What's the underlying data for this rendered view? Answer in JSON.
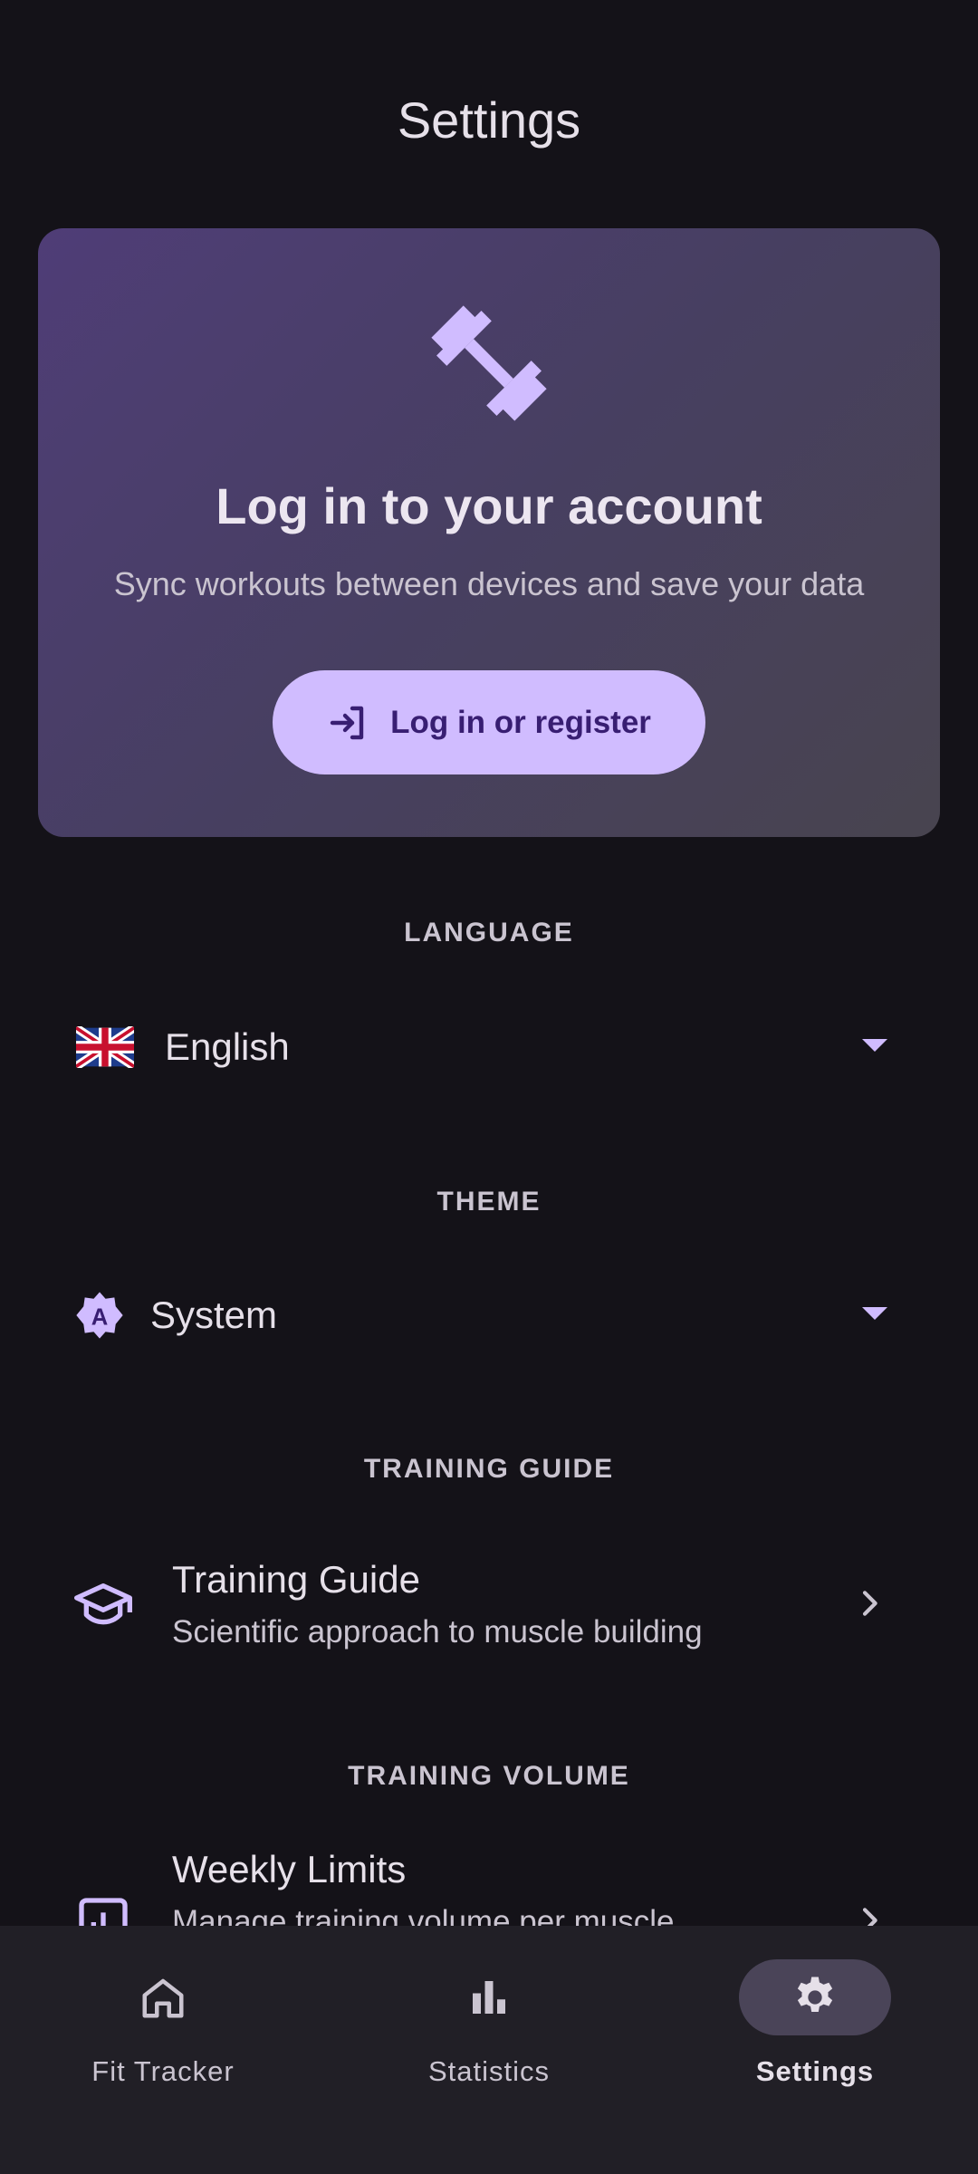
{
  "page": {
    "title": "Settings"
  },
  "login_card": {
    "icon": "dumbbell-icon",
    "title": "Log in to your account",
    "subtitle": "Sync workouts between devices and save your data",
    "button_label": "Log in or register",
    "button_icon": "login-icon"
  },
  "language": {
    "section_label": "LANGUAGE",
    "selected": "English",
    "flag_icon": "uk-flag-icon"
  },
  "theme": {
    "section_label": "THEME",
    "selected": "System",
    "icon": "auto-theme-icon"
  },
  "training_guide": {
    "section_label": "TRAINING GUIDE",
    "title": "Training Guide",
    "subtitle": "Scientific approach to muscle building",
    "icon": "graduation-cap-icon"
  },
  "training_volume": {
    "section_label": "TRAINING VOLUME",
    "title": "Weekly Limits",
    "subtitle": "Manage training volume per muscle",
    "icon": "chart-box-icon"
  },
  "bottom_nav": {
    "items": [
      {
        "label": "Fit Tracker",
        "icon": "home-icon"
      },
      {
        "label": "Statistics",
        "icon": "bar-chart-icon"
      },
      {
        "label": "Settings",
        "icon": "gear-icon"
      }
    ],
    "active": "Settings"
  },
  "colors": {
    "background": "#141218",
    "accent": "#D0BCFF",
    "on_accent": "#381E72",
    "card_start": "#4F3D77",
    "card_end": "#48444F",
    "nav_bg": "#211F26",
    "active_pill": "#4A4458"
  }
}
